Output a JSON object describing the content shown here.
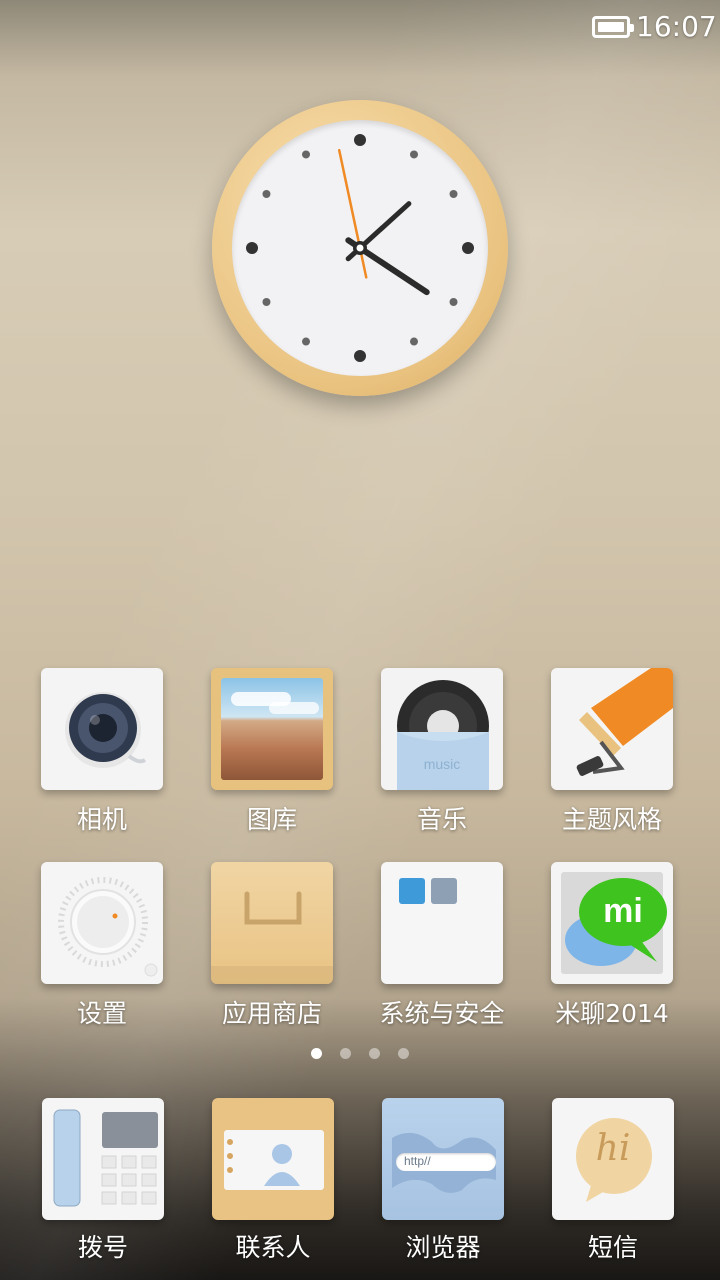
{
  "status_bar": {
    "time": "16:07"
  },
  "clock_widget": {
    "hour": 16,
    "minute": 7,
    "second": 58
  },
  "apps": [
    {
      "label": "相机",
      "icon": "camera-icon"
    },
    {
      "label": "图库",
      "icon": "gallery-icon"
    },
    {
      "label": "音乐",
      "icon": "music-icon",
      "badge_text": "music"
    },
    {
      "label": "主题风格",
      "icon": "theme-icon"
    },
    {
      "label": "设置",
      "icon": "settings-icon"
    },
    {
      "label": "应用商店",
      "icon": "app-store-icon"
    },
    {
      "label": "系统与安全",
      "icon": "system-security-folder-icon"
    },
    {
      "label": "米聊2014",
      "icon": "miliao-icon",
      "badge_text": "mi"
    }
  ],
  "page_indicator": {
    "count": 4,
    "active_index": 0
  },
  "dock": [
    {
      "label": "拨号",
      "icon": "phone-dialer-icon"
    },
    {
      "label": "联系人",
      "icon": "contacts-icon"
    },
    {
      "label": "浏览器",
      "icon": "browser-icon",
      "url_text": "http//"
    },
    {
      "label": "短信",
      "icon": "messages-icon",
      "badge_text": "hi"
    }
  ],
  "colors": {
    "wood": "#e9c27f",
    "accent_orange": "#f08a24",
    "mi_green": "#3fc31f",
    "browser_blue": "#a9c6e6"
  }
}
